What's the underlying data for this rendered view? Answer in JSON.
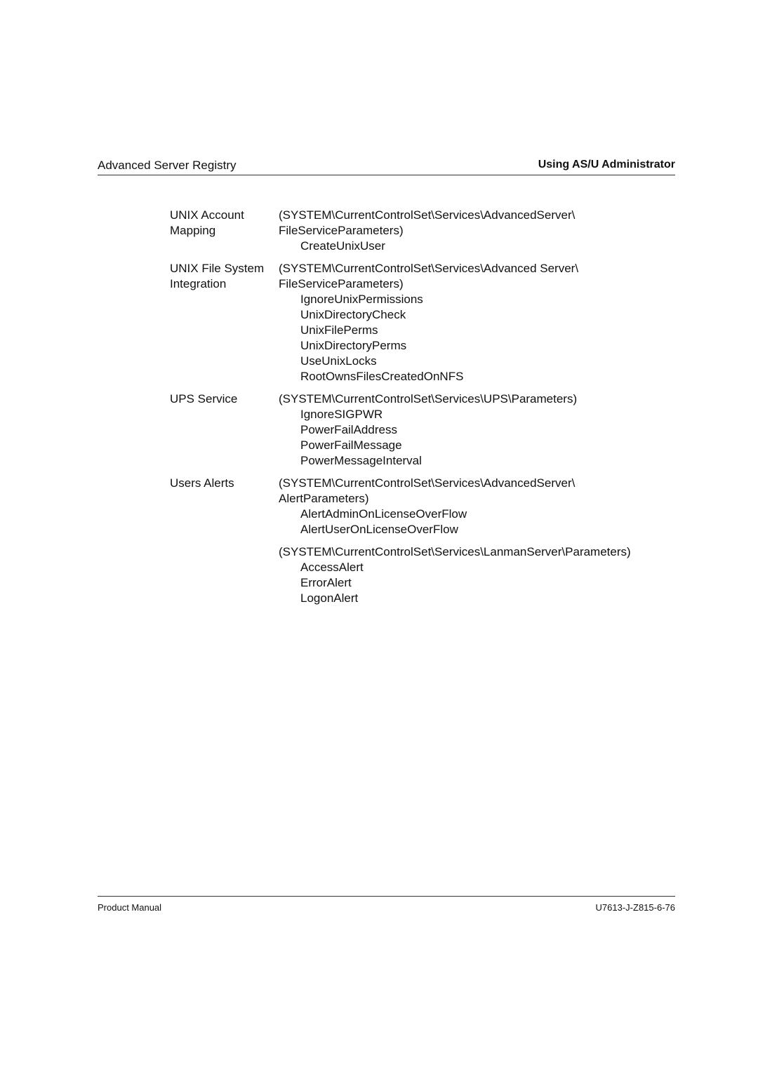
{
  "header": {
    "left": "Advanced Server Registry",
    "right": "Using AS/U Administrator"
  },
  "sections": [
    {
      "label": [
        "UNIX Account",
        "Mapping"
      ],
      "groups": [
        {
          "path": [
            "(SYSTEM\\CurrentControlSet\\Services\\AdvancedServer\\",
            "FileServiceParameters)"
          ],
          "values": [
            "CreateUnixUser"
          ]
        }
      ]
    },
    {
      "label": [
        "UNIX File System",
        "Integration"
      ],
      "groups": [
        {
          "path": [
            "(SYSTEM\\CurrentControlSet\\Services\\Advanced Server\\",
            "FileServiceParameters)"
          ],
          "values": [
            "IgnoreUnixPermissions",
            "UnixDirectoryCheck",
            "UnixFilePerms",
            "UnixDirectoryPerms",
            "UseUnixLocks",
            "RootOwnsFilesCreatedOnNFS"
          ]
        }
      ]
    },
    {
      "label": [
        "UPS Service"
      ],
      "groups": [
        {
          "path": [
            "(SYSTEM\\CurrentControlSet\\Services\\UPS\\Parameters)"
          ],
          "values": [
            "IgnoreSIGPWR",
            "PowerFailAddress",
            "PowerFailMessage",
            "PowerMessageInterval"
          ]
        }
      ]
    },
    {
      "label": [
        "Users Alerts"
      ],
      "groups": [
        {
          "path": [
            "(SYSTEM\\CurrentControlSet\\Services\\AdvancedServer\\",
            "AlertParameters)"
          ],
          "values": [
            "AlertAdminOnLicenseOverFlow",
            "AlertUserOnLicenseOverFlow"
          ]
        },
        {
          "path": [
            "(SYSTEM\\CurrentControlSet\\Services\\LanmanServer\\Parameters)"
          ],
          "values": [
            "AccessAlert",
            "ErrorAlert",
            "LogonAlert"
          ]
        }
      ]
    }
  ],
  "footer": {
    "left": "Product Manual",
    "right": "U7613-J-Z815-6-76"
  }
}
